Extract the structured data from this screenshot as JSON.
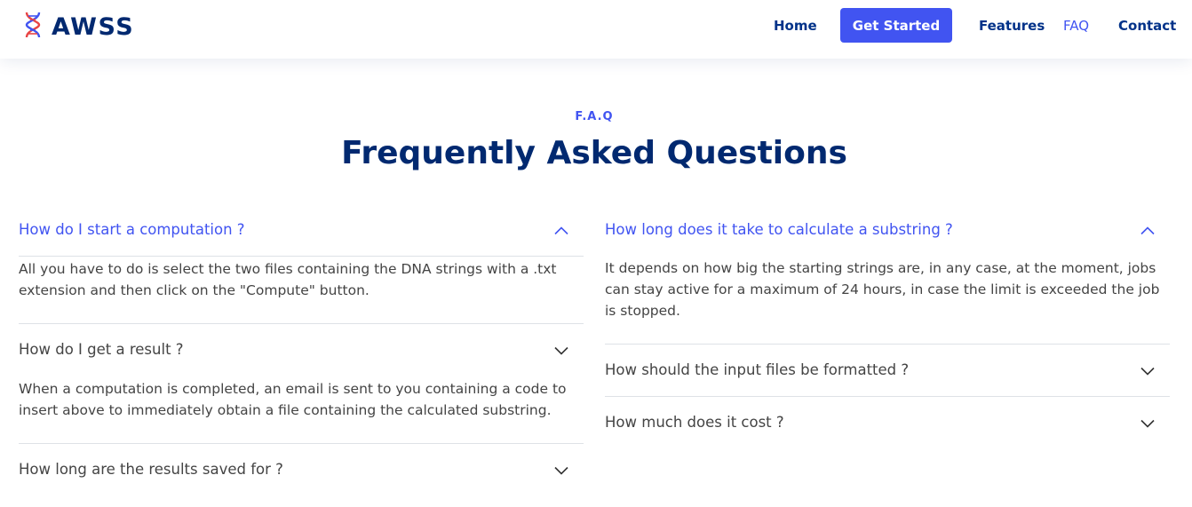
{
  "header": {
    "brand": "AWSS",
    "logo_icon": "dna-icon",
    "nav": {
      "home": "Home",
      "get_started": "Get Started",
      "features": "Features",
      "faq": "FAQ",
      "contact": "Contact"
    },
    "active_nav": "FAQ"
  },
  "section": {
    "eyebrow": "F.A.Q",
    "title": "Frequently Asked Questions"
  },
  "faq_left": [
    {
      "question": "How do I start a computation ?",
      "answer": "All you have to do is select the two files containing the DNA strings with a .txt extension and then click on the \"Compute\" button.",
      "expanded": true
    },
    {
      "question": "How do I get a result ?",
      "answer": "When a computation is completed, an email is sent to you containing a code to insert above to immediately obtain a file containing the calculated substring.",
      "expanded": false
    },
    {
      "question": "How long are the results saved for ?",
      "expanded": false
    }
  ],
  "faq_right": [
    {
      "question": "How long does it take to calculate a substring ?",
      "answer": "It depends on how big the starting strings are, in any case, at the moment, jobs can stay active for a maximum of 24 hours, in case the limit is exceeded the job is stopped.",
      "expanded": true
    },
    {
      "question": "How should the input files be formatted ?",
      "expanded": false
    },
    {
      "question": "How much does it cost ?",
      "expanded": false
    }
  ],
  "colors": {
    "accent": "#4154f1",
    "heading": "#012970",
    "nav_text": "#013289",
    "body_text": "#444444",
    "divider": "#dee2e6",
    "logo_red": "#e84545",
    "logo_blue": "#4154f1"
  }
}
